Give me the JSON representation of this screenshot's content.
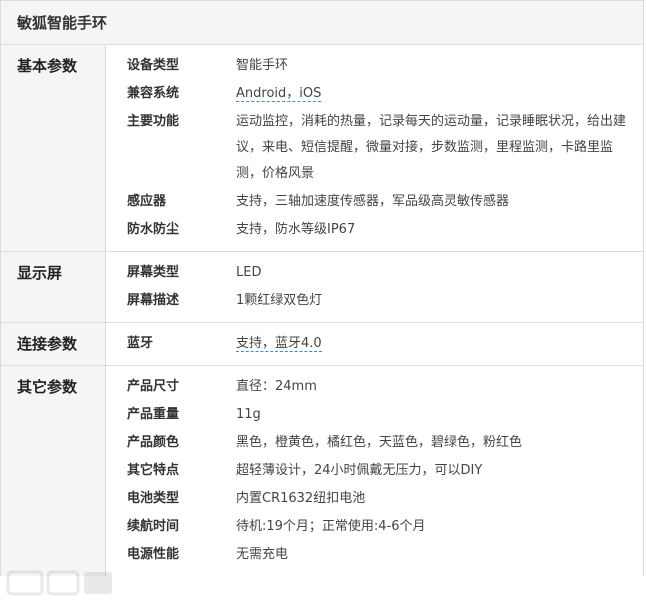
{
  "title": "敏狐智能手环",
  "sections": [
    {
      "name": "基本参数",
      "rows": [
        {
          "k": "设备类型",
          "v": "智能手环"
        },
        {
          "k": "兼容系统",
          "v": "Android，iOS"
        },
        {
          "k": "主要功能",
          "v": "运动监控，消耗的热量，记录每天的运动量，记录睡眠状况，给出建议，来电、短信提醒，微量对接，步数监测，里程监测，卡路里监测，价格风景"
        },
        {
          "k": "感应器",
          "v": "支持，三轴加速度传感器，军品级高灵敏传感器"
        },
        {
          "k": "防水防尘",
          "v": "支持，防水等级IP67"
        }
      ]
    },
    {
      "name": "显示屏",
      "rows": [
        {
          "k": "屏幕类型",
          "v": "LED"
        },
        {
          "k": "屏幕描述",
          "v": "1颗红绿双色灯"
        }
      ]
    },
    {
      "name": "连接参数",
      "rows": [
        {
          "k": "蓝牙",
          "v": "支持，蓝牙4.0"
        }
      ]
    },
    {
      "name": "其它参数",
      "rows": [
        {
          "k": "产品尺寸",
          "v": "直径：24mm"
        },
        {
          "k": "产品重量",
          "v": "11g"
        },
        {
          "k": "产品颜色",
          "v": "黑色，橙黄色，橘红色，天蓝色，碧绿色，粉红色"
        },
        {
          "k": "其它特点",
          "v": "超轻薄设计，24小时佩戴无压力，可以DIY"
        },
        {
          "k": "电池类型",
          "v": "内置CR1632纽扣电池"
        },
        {
          "k": "续航时间",
          "v": "待机:19个月；正常使用:4-6个月"
        },
        {
          "k": "电源性能",
          "v": "无需充电"
        }
      ]
    }
  ]
}
